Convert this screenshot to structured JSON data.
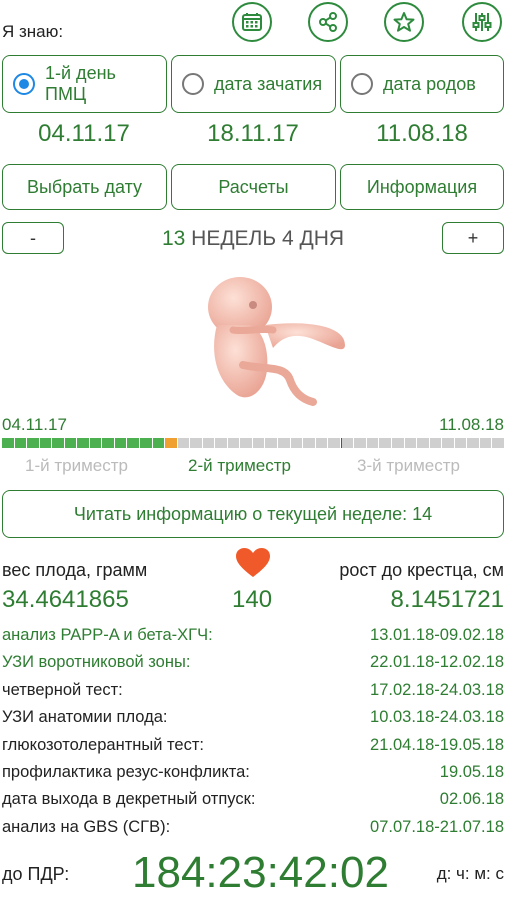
{
  "header": {
    "i_know_label": "Я знаю:",
    "icons": [
      "calendar-icon",
      "share-icon",
      "star-icon",
      "settings-sliders-icon"
    ]
  },
  "options": [
    {
      "label": "1-й день ПМЦ",
      "selected": true,
      "date": "04.11.17"
    },
    {
      "label": "дата зачатия",
      "selected": false,
      "date": "18.11.17"
    },
    {
      "label": "дата родов",
      "selected": false,
      "date": "11.08.18"
    }
  ],
  "buttons": {
    "choose_date": "Выбрать дату",
    "calculations": "Расчеты",
    "information": "Информация"
  },
  "week": {
    "minus": "-",
    "plus": "+",
    "weeks_green": "13",
    "rest": "НЕДЕЛЬ 4 ДНЯ"
  },
  "timeline": {
    "start": "04.11.17",
    "end": "11.08.18",
    "progress_weeks": 13,
    "total_weeks": 40,
    "trimesters": [
      "1-й триместр",
      "2-й триместр",
      "3-й триместр"
    ],
    "active_trimester": 1,
    "colors": {
      "done": "#4caf50",
      "current": "#f0a030",
      "pending": "#cfcfcf"
    }
  },
  "read_week_button": "Читать информацию о текущей неделе: 14",
  "stats": {
    "weight_label": "вес плода, грамм",
    "weight_value": "34.4641865",
    "heart_value": "140",
    "height_label": "рост до крестца, см",
    "height_value": "8.1451721"
  },
  "events": [
    {
      "name": "анализ PAPP-A и бета-ХГЧ:",
      "date": "13.01.18-09.02.18",
      "highlight": true
    },
    {
      "name": "УЗИ воротниковой зоны:",
      "date": "22.01.18-12.02.18",
      "highlight": true
    },
    {
      "name": "четверной тест:",
      "date": "17.02.18-24.03.18",
      "highlight": false
    },
    {
      "name": "УЗИ анатомии плода:",
      "date": "10.03.18-24.03.18",
      "highlight": false
    },
    {
      "name": "глюкозотолерантный тест:",
      "date": "21.04.18-19.05.18",
      "highlight": false
    },
    {
      "name": "профилактика резус-конфликта:",
      "date": "19.05.18",
      "highlight": false
    },
    {
      "name": "дата выхода в декретный отпуск:",
      "date": "02.06.18",
      "highlight": false
    },
    {
      "name": "анализ на GBS (СГВ):",
      "date": "07.07.18-21.07.18",
      "highlight": false
    }
  ],
  "countdown": {
    "label": "до ПДР:",
    "value": "184:23:42:02",
    "units": "д: ч: м: с"
  }
}
